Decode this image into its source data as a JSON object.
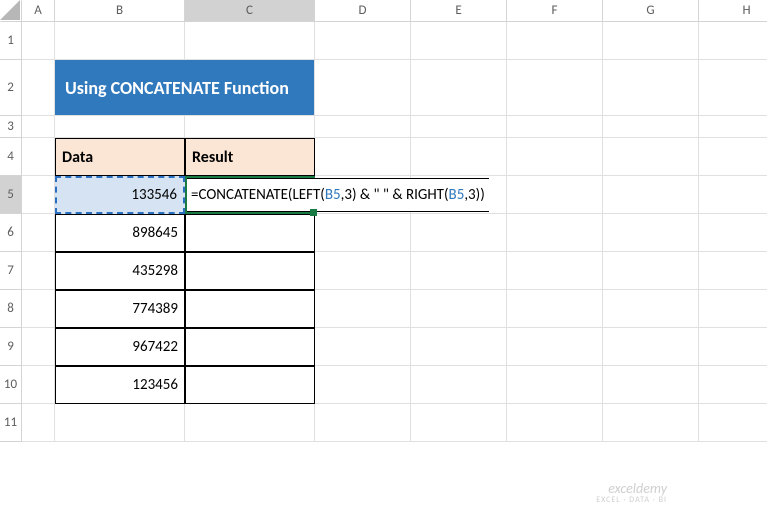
{
  "columns": [
    "A",
    "B",
    "C",
    "D",
    "E",
    "F",
    "G",
    "H"
  ],
  "rows": [
    "1",
    "2",
    "3",
    "4",
    "5",
    "6",
    "7",
    "8",
    "9",
    "10",
    "11"
  ],
  "title": "Using CONCATENATE Function",
  "headers": {
    "data": "Data",
    "result": "Result"
  },
  "data_values": [
    "133546",
    "898645",
    "435298",
    "774389",
    "967422",
    "123456"
  ],
  "formula": {
    "prefix": "=CONCATENATE(LEFT(",
    "ref1": "B5",
    "mid1": ",3) & \" \" & RIGHT(",
    "ref2": "B5",
    "mid2": ",3))"
  },
  "active_cell": "C5",
  "selected_column": "C",
  "selected_row": "5",
  "watermark": {
    "main": "exceldemy",
    "sub": "EXCEL · DATA · BI"
  },
  "chart_data": {
    "type": "table",
    "title": "Using CONCATENATE Function",
    "columns": [
      "Data",
      "Result"
    ],
    "rows": [
      [
        "133546",
        "=CONCATENATE(LEFT(B5,3) & \" \" & RIGHT(B5,3))"
      ],
      [
        "898645",
        ""
      ],
      [
        "435298",
        ""
      ],
      [
        "774389",
        ""
      ],
      [
        "967422",
        ""
      ],
      [
        "123456",
        ""
      ]
    ]
  }
}
